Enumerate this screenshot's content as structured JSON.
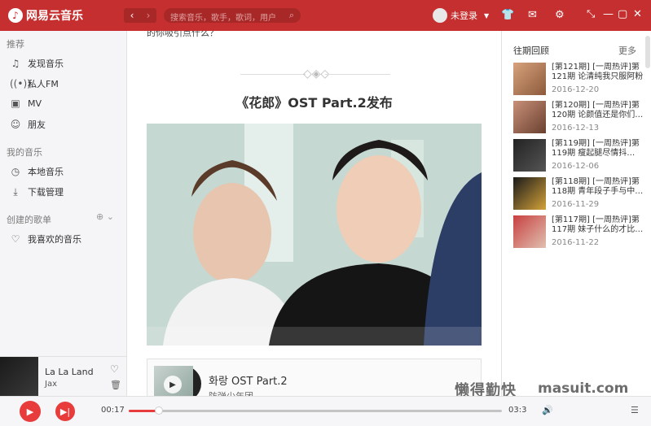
{
  "app": {
    "title": "网易云音乐"
  },
  "search": {
    "placeholder": "搜索音乐，歌手，歌词，用户"
  },
  "user": {
    "label": "未登录"
  },
  "sidebar": {
    "sections": [
      {
        "label": "推荐"
      },
      {
        "label": "我的音乐"
      },
      {
        "label": "创建的歌单"
      }
    ],
    "items": [
      {
        "label": "发现音乐",
        "icon": "music-note-icon"
      },
      {
        "label": "私人FM",
        "icon": "radio-icon"
      },
      {
        "label": "MV",
        "icon": "video-icon"
      },
      {
        "label": "朋友",
        "icon": "friends-icon"
      },
      {
        "label": "本地音乐",
        "icon": "local-music-icon"
      },
      {
        "label": "下载管理",
        "icon": "download-icon"
      },
      {
        "label": "我喜欢的音乐",
        "icon": "heart-icon"
      }
    ]
  },
  "now_playing": {
    "title": "La La Land",
    "artist": "Jax"
  },
  "main": {
    "cut_text": "的你吸引点什么？",
    "article_title": "《花郎》OST Part.2发布",
    "song_card": {
      "title": "화랑 OST Part.2",
      "artist": "防弹少年团"
    }
  },
  "right": {
    "heading": "往期回顾",
    "more": "更多",
    "issues": [
      {
        "title": "[第121期] [一周热评]第121期 论清纯我只服阿粉",
        "date": "2016-12-20"
      },
      {
        "title": "[第120期] [一周热评]第120期 论颜值还是你们…",
        "date": "2016-12-13"
      },
      {
        "title": "[第119期] [一周热评]第119期 瘦起腿尽情抖…",
        "date": "2016-12-06"
      },
      {
        "title": "[第118期] [一周热评]第118期 青年段子手与中…",
        "date": "2016-11-29"
      },
      {
        "title": "[第117期] [一周热评]第117期 妹子什么的才比…",
        "date": "2016-11-22"
      }
    ]
  },
  "player": {
    "current_time": "00:17",
    "total_time": "03:3",
    "progress": 0.08
  },
  "watermark": {
    "text": "懒得勤快",
    "site": "masuit.com"
  },
  "colors": {
    "accent": "#c62f2f",
    "play": "#e83c3c"
  }
}
